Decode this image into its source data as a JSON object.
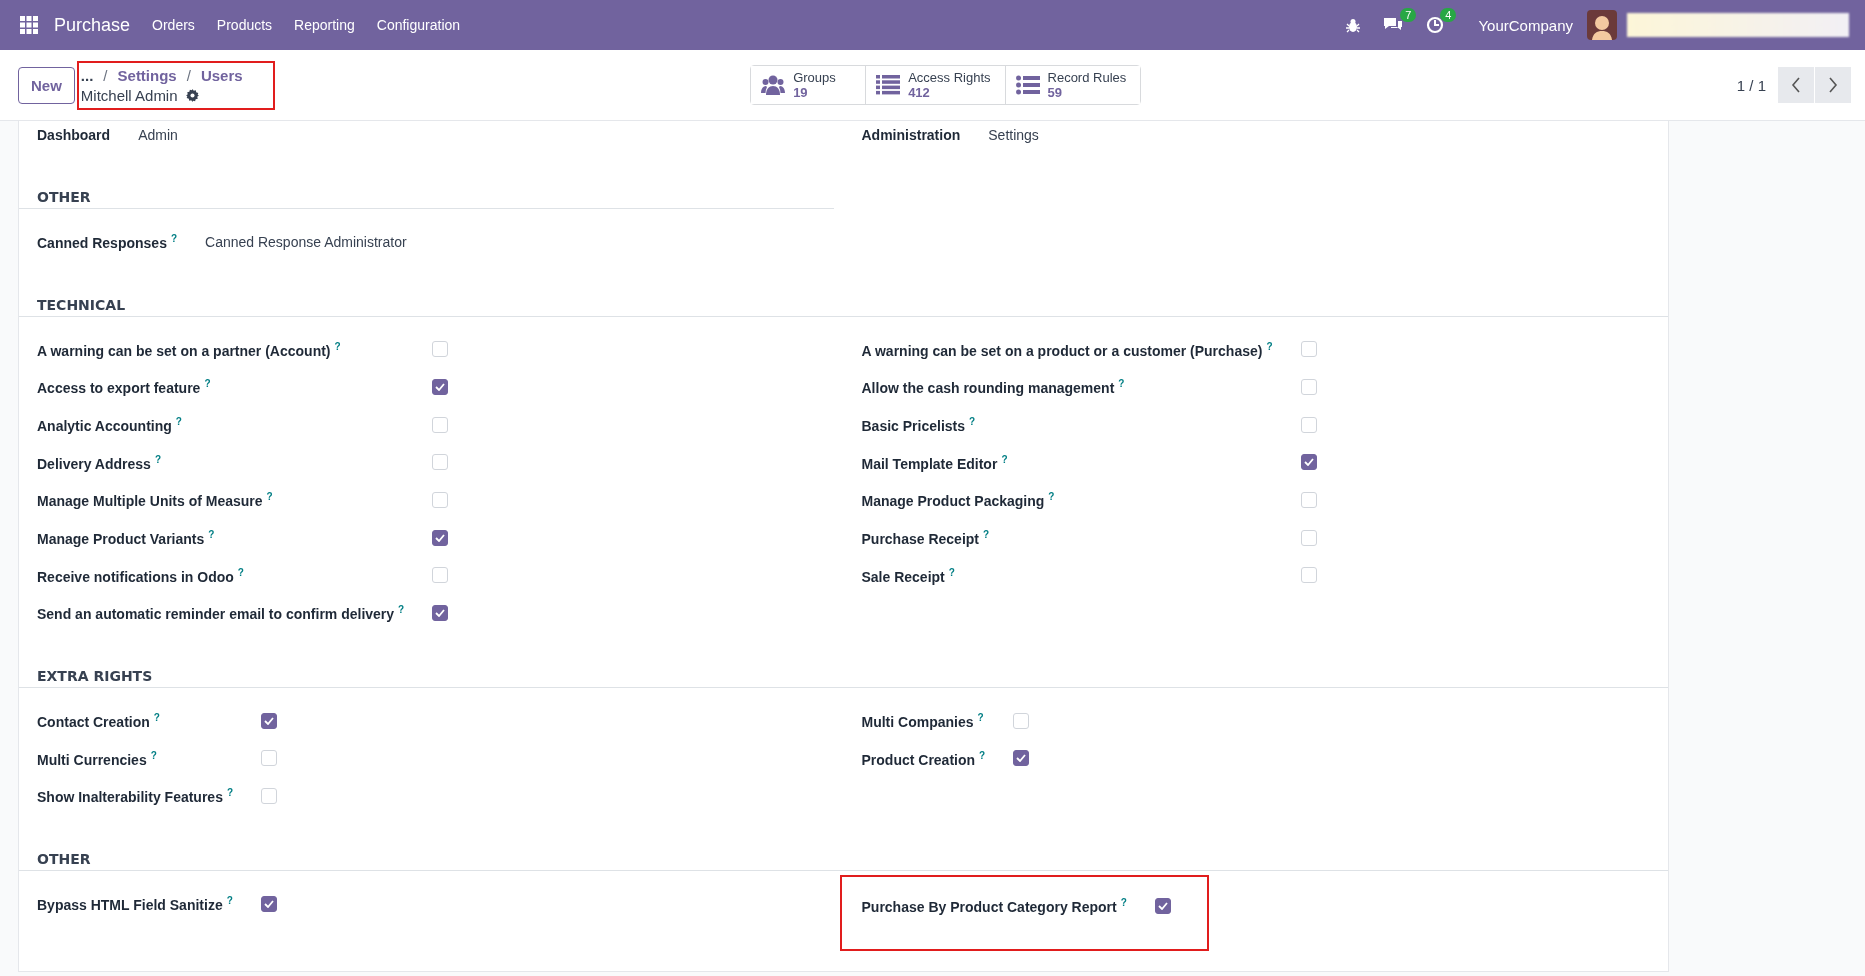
{
  "navbar": {
    "app": "Purchase",
    "menus": [
      "Orders",
      "Products",
      "Reporting",
      "Configuration"
    ],
    "messages_badge": "7",
    "activities_badge": "4",
    "company": "YourCompany"
  },
  "control_panel": {
    "new_button": "New",
    "breadcrumb": {
      "highlighted": true,
      "ellipsis": "...",
      "separator": "/",
      "items": [
        "Settings",
        "Users"
      ],
      "record": "Mitchell Admin"
    },
    "smart_buttons": [
      {
        "label": "Groups",
        "count": "19",
        "kind": "users"
      },
      {
        "label": "Access Rights",
        "count": "412",
        "kind": "list"
      },
      {
        "label": "Record Rules",
        "count": "59",
        "kind": "bullets"
      }
    ],
    "pager": "1 / 1"
  },
  "sections": [
    {
      "left": [
        {
          "kind": "value",
          "label": "Dashboard",
          "value": "Admin"
        }
      ],
      "right": [
        {
          "kind": "value",
          "label": "Administration",
          "value": "Settings"
        }
      ]
    },
    {
      "title": "OTHER",
      "left": [
        {
          "kind": "value",
          "label": "Canned Responses",
          "help": "?",
          "value": "Canned Response Administrator"
        }
      ]
    },
    {
      "title": "TECHNICAL",
      "left": [
        {
          "kind": "checkbox",
          "label": "A warning can be set on a partner (Account)",
          "help": "?",
          "checked": false
        },
        {
          "kind": "checkbox",
          "label": "Access to export feature",
          "help": "?",
          "checked": true
        },
        {
          "kind": "checkbox",
          "label": "Analytic Accounting",
          "help": "?",
          "checked": false
        },
        {
          "kind": "checkbox",
          "label": "Delivery Address",
          "help": "?",
          "checked": false
        },
        {
          "kind": "checkbox",
          "label": "Manage Multiple Units of Measure",
          "help": "?",
          "checked": false
        },
        {
          "kind": "checkbox",
          "label": "Manage Product Variants",
          "help": "?",
          "checked": true
        },
        {
          "kind": "checkbox",
          "label": "Receive notifications in Odoo",
          "help": "?",
          "checked": false
        },
        {
          "kind": "checkbox",
          "label": "Send an automatic reminder email to confirm delivery",
          "help": "?",
          "checked": true
        }
      ],
      "right": [
        {
          "kind": "checkbox",
          "label": "A warning can be set on a product or a customer (Purchase)",
          "help": "?",
          "checked": false
        },
        {
          "kind": "checkbox",
          "label": "Allow the cash rounding management",
          "help": "?",
          "checked": false
        },
        {
          "kind": "checkbox",
          "label": "Basic Pricelists",
          "help": "?",
          "checked": false
        },
        {
          "kind": "checkbox",
          "label": "Mail Template Editor",
          "help": "?",
          "checked": true
        },
        {
          "kind": "checkbox",
          "label": "Manage Product Packaging",
          "help": "?",
          "checked": false
        },
        {
          "kind": "checkbox",
          "label": "Purchase Receipt",
          "help": "?",
          "checked": false
        },
        {
          "kind": "checkbox",
          "label": "Sale Receipt",
          "help": "?",
          "checked": false
        }
      ]
    },
    {
      "title": "EXTRA RIGHTS",
      "left": [
        {
          "kind": "checkbox",
          "label": "Contact Creation",
          "help": "?",
          "checked": true
        },
        {
          "kind": "checkbox",
          "label": "Multi Currencies",
          "help": "?",
          "checked": false
        },
        {
          "kind": "checkbox",
          "label": "Show Inalterability Features",
          "help": "?",
          "checked": false
        }
      ],
      "right": [
        {
          "kind": "checkbox",
          "label": "Multi Companies",
          "help": "?",
          "checked": false
        },
        {
          "kind": "checkbox",
          "label": "Product Creation",
          "help": "?",
          "checked": true
        }
      ]
    },
    {
      "title": "OTHER",
      "left": [
        {
          "kind": "checkbox",
          "label": "Bypass HTML Field Sanitize",
          "help": "?",
          "checked": true
        }
      ],
      "right": [
        {
          "kind": "checkbox",
          "label": "Purchase By Product Category Report",
          "help": "?",
          "checked": true,
          "highlighted": true
        }
      ]
    }
  ]
}
